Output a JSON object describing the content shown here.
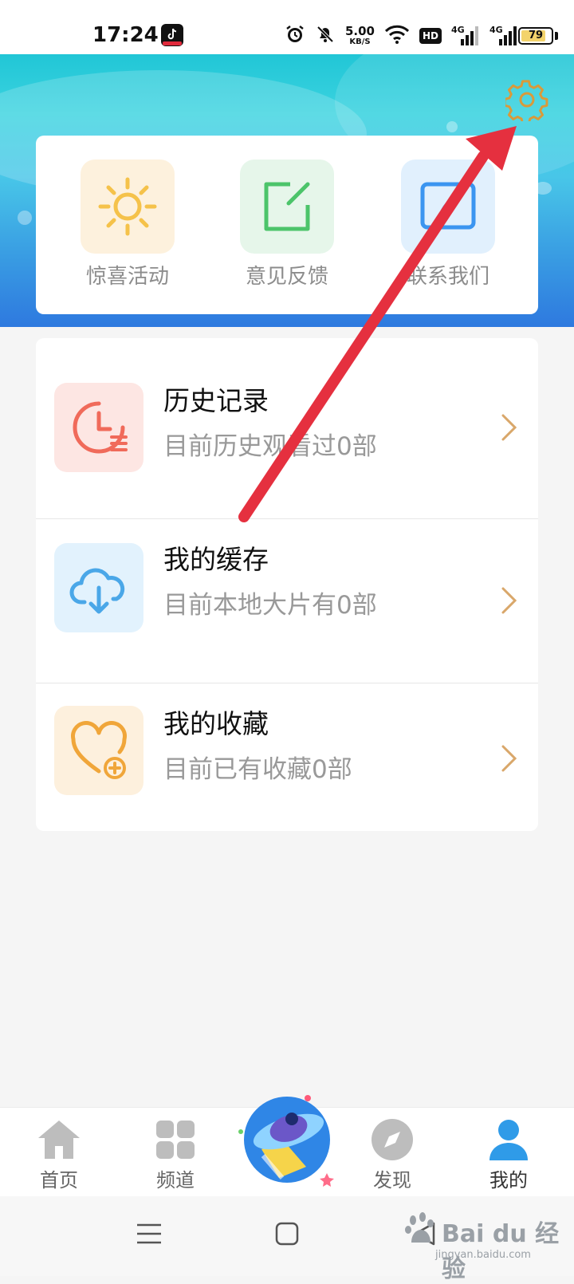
{
  "status_bar": {
    "time": "17:24",
    "net_speed_value": "5.00",
    "net_speed_unit": "KB/S",
    "hd_label": "HD",
    "signal1_label": "4G",
    "signal2_label": "4G",
    "battery_percent": "79",
    "icons": [
      "tiktok-app-icon",
      "alarm-icon",
      "mute-icon",
      "wifi-icon",
      "hd-voice-icon",
      "signal-4g-icon",
      "signal-4g-icon",
      "battery-icon"
    ]
  },
  "header": {
    "settings_icon": "gear-icon",
    "colors": {
      "accent_light": "#3bd3e0",
      "accent_dark": "#2e79df"
    }
  },
  "quick_actions": [
    {
      "label": "惊喜活动",
      "icon": "sun-icon",
      "bg": "#fdf1dd",
      "color": "#f5c24a"
    },
    {
      "label": "意见反馈",
      "icon": "edit-note-icon",
      "bg": "#e6f6ea",
      "color": "#4cc46a"
    },
    {
      "label": "联系我们",
      "icon": "message-rocket-icon",
      "bg": "#e1f0fd",
      "color": "#3b95f0"
    }
  ],
  "list": [
    {
      "title": "历史记录",
      "subtitle": "目前历史观看过0部",
      "icon": "clock-list-icon",
      "bg": "#fde6e3",
      "color": "#f06a5a"
    },
    {
      "title": "我的缓存",
      "subtitle": "目前本地大片有0部",
      "icon": "cloud-download-icon",
      "bg": "#e2f2fd",
      "color": "#4aa7e8"
    },
    {
      "title": "我的收藏",
      "subtitle": "目前已有收藏0部",
      "icon": "heart-plus-icon",
      "bg": "#fdf0dd",
      "color": "#f0a63a"
    }
  ],
  "bottom_nav": [
    {
      "label": "首页",
      "icon": "home-icon",
      "active": false
    },
    {
      "label": "频道",
      "icon": "grid-icon",
      "active": false
    },
    {
      "label": "",
      "icon": "ufo-icon",
      "active": false
    },
    {
      "label": "发现",
      "icon": "compass-icon",
      "active": false
    },
    {
      "label": "我的",
      "icon": "user-icon",
      "active": true
    }
  ],
  "system_nav": {
    "icons": [
      "menu-icon",
      "home-square-icon",
      "back-triangle-icon"
    ]
  },
  "watermark": {
    "text": "Bai du 经验",
    "url": "jingyan.baidu.com"
  },
  "annotation": {
    "type": "red-arrow",
    "color": "#e5303f"
  }
}
